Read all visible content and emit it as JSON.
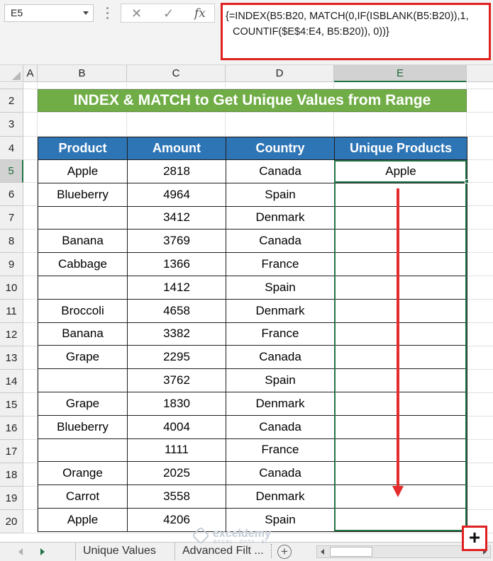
{
  "name_box": {
    "value": "E5"
  },
  "formula_bar": {
    "cancel_icon": "close-icon",
    "enter_icon": "check-icon",
    "fx_label": "fx",
    "formula_line1": "{=INDEX(B5:B20, MATCH(0,IF(ISBLANK(B5:B20)),1,",
    "formula_line2": "COUNTIF($E$4:E4, B5:B20)), 0))}"
  },
  "columns": [
    "A",
    "B",
    "C",
    "D",
    "E"
  ],
  "rows": [
    "2",
    "3",
    "4",
    "5",
    "6",
    "7",
    "8",
    "9",
    "10",
    "11",
    "12",
    "13",
    "14",
    "15",
    "16",
    "17",
    "18",
    "19",
    "20"
  ],
  "title": "INDEX & MATCH to Get Unique Values from Range",
  "table": {
    "headers": [
      "Product",
      "Amount",
      "Country",
      "Unique Products"
    ],
    "rows": [
      [
        "Apple",
        "2818",
        "Canada",
        "Apple"
      ],
      [
        "Blueberry",
        "4964",
        "Spain",
        ""
      ],
      [
        "",
        "3412",
        "Denmark",
        ""
      ],
      [
        "Banana",
        "3769",
        "Canada",
        ""
      ],
      [
        "Cabbage",
        "1366",
        "France",
        ""
      ],
      [
        "",
        "1412",
        "Spain",
        ""
      ],
      [
        "Broccoli",
        "4658",
        "Denmark",
        ""
      ],
      [
        "Banana",
        "3382",
        "France",
        ""
      ],
      [
        "Grape",
        "2295",
        "Canada",
        ""
      ],
      [
        "",
        "3762",
        "Spain",
        ""
      ],
      [
        "Grape",
        "1830",
        "Denmark",
        ""
      ],
      [
        "Blueberry",
        "4004",
        "Canada",
        ""
      ],
      [
        "",
        "1111",
        "France",
        ""
      ],
      [
        "Orange",
        "2025",
        "Canada",
        ""
      ],
      [
        "Carrot",
        "3558",
        "Denmark",
        ""
      ],
      [
        "Apple",
        "4206",
        "Spain",
        ""
      ]
    ]
  },
  "sheet_tabs": [
    "Unique Values",
    "Advanced Filt ..."
  ],
  "add_sheet_label": "+",
  "watermark": {
    "name": "exceldemy",
    "sub": "EXCEL · DATA · BI"
  },
  "fill_cursor": "+",
  "colors": {
    "title_bg": "#71ad47",
    "header_bg": "#2e75b6",
    "selection": "#217346",
    "highlight": "#e02020"
  }
}
